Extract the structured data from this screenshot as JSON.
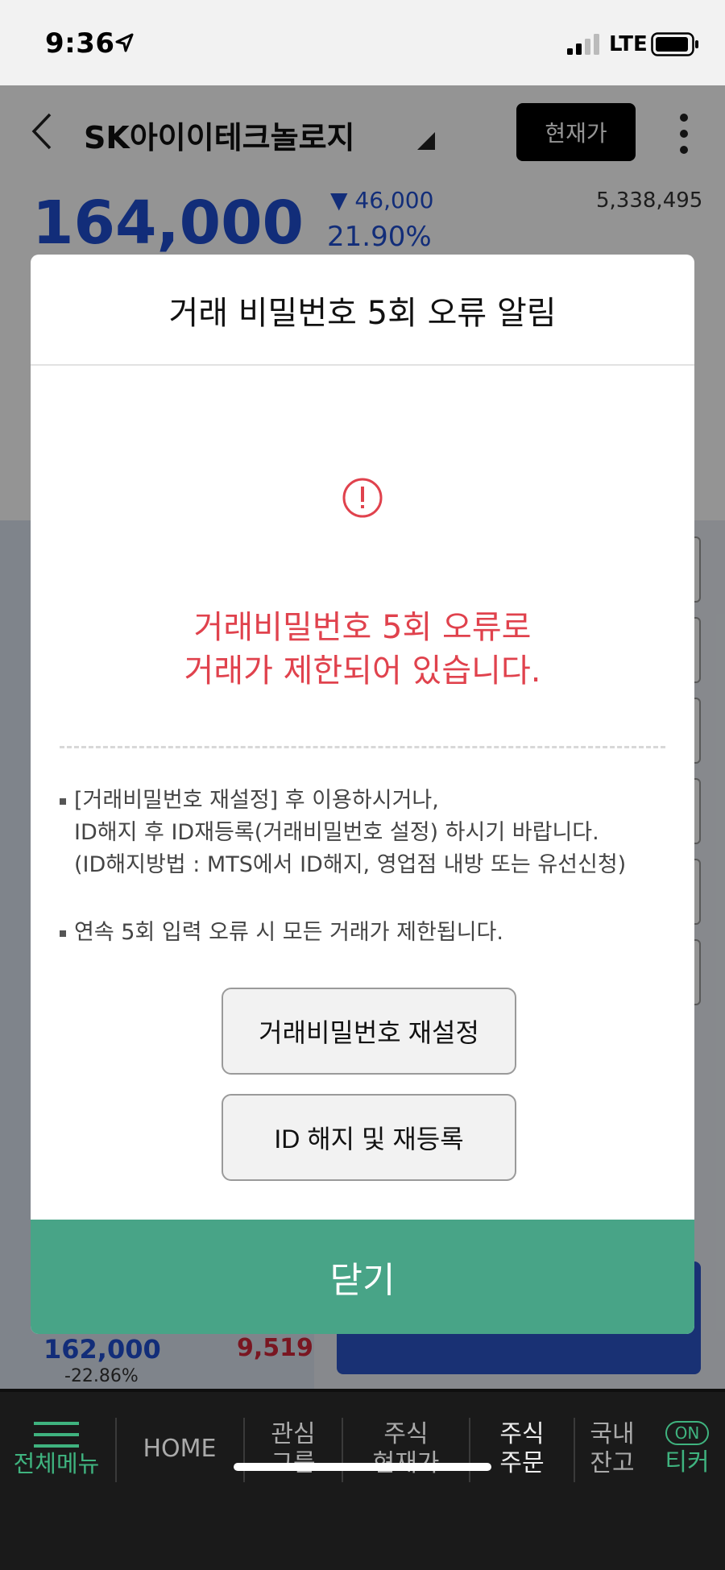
{
  "status_bar": {
    "time": "9:36",
    "network": "LTE"
  },
  "header": {
    "stock_name": "SK아이이테크놀로지",
    "current_price_button": "현재가"
  },
  "quote": {
    "price": "164,000",
    "change": "▼ 46,000",
    "change_pct": "21.90%",
    "volume": "5,338,495"
  },
  "orderbook_row": {
    "price": "162,000",
    "pct": "-22.86%",
    "qty": "9,519"
  },
  "bottom_nav": {
    "items": [
      {
        "label": "전체메뉴"
      },
      {
        "label": "HOME"
      },
      {
        "label": "관심\n그룹"
      },
      {
        "label": "주식\n현재가"
      },
      {
        "label": "주식\n주문"
      },
      {
        "label": "국내\n잔고"
      },
      {
        "label": "티커",
        "badge": "ON"
      }
    ]
  },
  "modal": {
    "title": "거래 비밀번호 5회 오류 알림",
    "message_line1": "거래비밀번호 5회 오류로",
    "message_line2": "거래가 제한되어 있습니다.",
    "note1_line1": "[거래비밀번호 재설정] 후 이용하시거나,",
    "note1_line2": "ID해지 후 ID재등록(거래비밀번호 설정) 하시기 바랍니다.",
    "note1_line3": "(ID해지방법 : MTS에서 ID해지, 영업점 내방 또는 유선신청)",
    "note2": "연속 5회 입력 오류 시 모든 거래가 제한됩니다.",
    "reset_button": "거래비밀번호 재설정",
    "id_button": "ID 해지 및 재등록",
    "close_button": "닫기"
  },
  "colors": {
    "alert_red": "#e0424d",
    "close_green": "#48a487",
    "price_blue": "#1f4fd0"
  }
}
